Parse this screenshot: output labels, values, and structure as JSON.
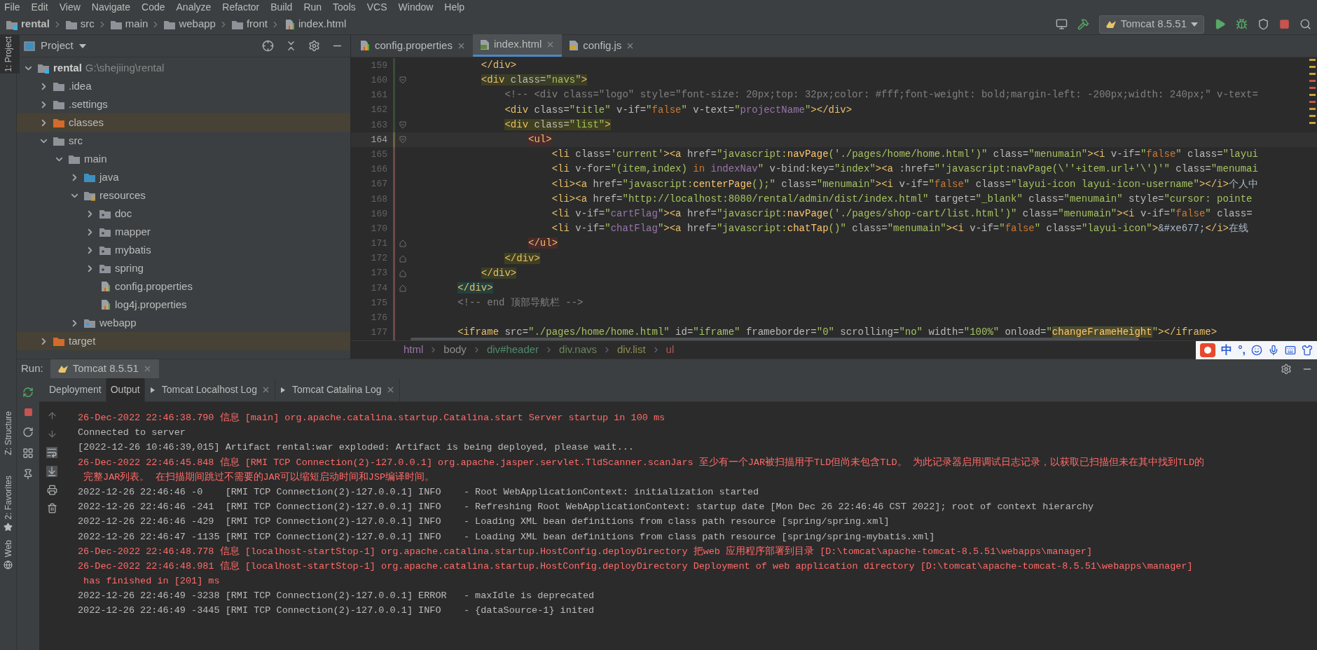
{
  "menu": [
    "File",
    "Edit",
    "View",
    "Navigate",
    "Code",
    "Analyze",
    "Refactor",
    "Build",
    "Run",
    "Tools",
    "VCS",
    "Window",
    "Help"
  ],
  "navbar": {
    "crumbs": [
      "rental",
      "src",
      "main",
      "webapp",
      "front",
      "index.html"
    ],
    "run_config": "Tomcat 8.5.51"
  },
  "side_tabs": [
    {
      "label": "1: Project",
      "selected": true
    },
    {
      "label": "Z: Structure",
      "selected": false
    },
    {
      "label": "2: Favorites",
      "selected": false
    },
    {
      "label": "Web",
      "selected": false
    }
  ],
  "project": {
    "title": "Project",
    "tree": [
      {
        "name": "rental",
        "path": "G:\\shejiing\\rental",
        "kind": "module",
        "expanded": true,
        "children": [
          {
            "name": ".idea",
            "kind": "folder",
            "expanded": false
          },
          {
            "name": ".settings",
            "kind": "folder",
            "expanded": false
          },
          {
            "name": "classes",
            "kind": "excluded",
            "expanded": false
          },
          {
            "name": "src",
            "kind": "folder",
            "expanded": true,
            "children": [
              {
                "name": "main",
                "kind": "folder",
                "expanded": true,
                "children": [
                  {
                    "name": "java",
                    "kind": "source",
                    "expanded": false
                  },
                  {
                    "name": "resources",
                    "kind": "resources",
                    "expanded": true,
                    "children": [
                      {
                        "name": "doc",
                        "kind": "package",
                        "expanded": false
                      },
                      {
                        "name": "mapper",
                        "kind": "package",
                        "expanded": false
                      },
                      {
                        "name": "mybatis",
                        "kind": "package",
                        "expanded": false
                      },
                      {
                        "name": "spring",
                        "kind": "package",
                        "expanded": false
                      },
                      {
                        "name": "config.properties",
                        "kind": "properties"
                      },
                      {
                        "name": "log4j.properties",
                        "kind": "properties"
                      }
                    ]
                  },
                  {
                    "name": "webapp",
                    "kind": "web",
                    "expanded": false
                  }
                ]
              }
            ]
          },
          {
            "name": "target",
            "kind": "excluded",
            "expanded": false
          }
        ]
      }
    ]
  },
  "editor": {
    "tabs": [
      {
        "label": "config.properties",
        "kind": "properties",
        "selected": false
      },
      {
        "label": "index.html",
        "kind": "html",
        "selected": true
      },
      {
        "label": "config.js",
        "kind": "js",
        "selected": false
      }
    ],
    "lines": [
      {
        "number": "159",
        "current": false,
        "kind": "added",
        "fold_start": false,
        "fold_end": false,
        "tokens": [
          {
            "kind": "tag",
            "text": "            </div>"
          }
        ]
      },
      {
        "number": "160",
        "current": false,
        "kind": "added",
        "fold_start": true,
        "fold_end": false,
        "color": "#3b3d26",
        "tokens": [
          {
            "kind": "tag",
            "text": "            <div"
          },
          {
            "kind": "attr",
            "text": " class="
          },
          {
            "kind": "str",
            "text": "\"navs\""
          },
          {
            "kind": "tag",
            "text": ">"
          }
        ]
      },
      {
        "number": "161",
        "current": false,
        "kind": "added",
        "fold_start": false,
        "fold_end": false,
        "tokens": [
          {
            "kind": "cmt",
            "text": "                <!-- <div class=\"logo\" style=\"font-size: 20px;top: 32px;color: #fff;font-weight: bold;margin-left: -200px;width: 240px;\" v-text="
          }
        ]
      },
      {
        "number": "162",
        "current": false,
        "kind": "added",
        "fold_start": false,
        "fold_end": false,
        "tokens": [
          {
            "kind": "tag",
            "text": "                <div"
          },
          {
            "kind": "attr",
            "text": " class="
          },
          {
            "kind": "str",
            "text": "\"title\""
          },
          {
            "kind": "attr",
            "text": " v-if="
          },
          {
            "kind": "str",
            "text": "\""
          },
          {
            "kind": "kw",
            "text": "false"
          },
          {
            "kind": "str",
            "text": "\""
          },
          {
            "kind": "attr",
            "text": " v-text="
          },
          {
            "kind": "str",
            "text": "\""
          },
          {
            "kind": "var",
            "text": "projectName"
          },
          {
            "kind": "str",
            "text": "\""
          },
          {
            "kind": "tag",
            "text": "></div>"
          }
        ]
      },
      {
        "number": "163",
        "current": false,
        "kind": "added",
        "fold_start": true,
        "fold_end": false,
        "color": "#40401f",
        "tokens": [
          {
            "kind": "tag",
            "text": "                <div"
          },
          {
            "kind": "attr",
            "text": " class="
          },
          {
            "kind": "str",
            "text": "\"list\""
          },
          {
            "kind": "tag",
            "text": ">"
          }
        ]
      },
      {
        "number": "164",
        "current": true,
        "kind": "modified",
        "fold_start": true,
        "fold_end": false,
        "color": "#4a2a2a",
        "tokens": [
          {
            "kind": "tag",
            "text": "                    <ul>"
          }
        ]
      },
      {
        "number": "165",
        "current": false,
        "kind": "changed",
        "fold_start": false,
        "fold_end": false,
        "tokens": [
          {
            "kind": "tag",
            "text": "                        <li"
          },
          {
            "kind": "attr",
            "text": " class="
          },
          {
            "kind": "str",
            "text": "'current'"
          },
          {
            "kind": "tag",
            "text": "><a"
          },
          {
            "kind": "attr",
            "text": " href="
          },
          {
            "kind": "str",
            "text": "\"javascript:"
          },
          {
            "kind": "fn",
            "text": "navPage"
          },
          {
            "kind": "str",
            "text": "('./pages/home/home.html')\""
          },
          {
            "kind": "attr",
            "text": " class="
          },
          {
            "kind": "str",
            "text": "\"menumain\""
          },
          {
            "kind": "tag",
            "text": "><i"
          },
          {
            "kind": "attr",
            "text": " v-if="
          },
          {
            "kind": "str",
            "text": "\""
          },
          {
            "kind": "kw",
            "text": "false"
          },
          {
            "kind": "str",
            "text": "\""
          },
          {
            "kind": "attr",
            "text": " class="
          },
          {
            "kind": "str",
            "text": "\"layui"
          }
        ]
      },
      {
        "number": "166",
        "current": false,
        "kind": "changed",
        "fold_start": false,
        "fold_end": false,
        "tokens": [
          {
            "kind": "tag",
            "text": "                        <li"
          },
          {
            "kind": "attr",
            "text": " v-for="
          },
          {
            "kind": "str",
            "text": "\"(item,index)"
          },
          {
            "kind": "kw",
            "text": " in"
          },
          {
            "kind": "var",
            "text": " indexNav"
          },
          {
            "kind": "str",
            "text": "\""
          },
          {
            "kind": "attr",
            "text": " v-bind:key="
          },
          {
            "kind": "str",
            "text": "\"index\""
          },
          {
            "kind": "tag",
            "text": "><a"
          },
          {
            "kind": "attr",
            "text": " :href="
          },
          {
            "kind": "str",
            "text": "\"'javascript:navPage(\\''+item.url+'\\')'\""
          },
          {
            "kind": "attr",
            "text": " class="
          },
          {
            "kind": "str",
            "text": "\"menumai"
          }
        ]
      },
      {
        "number": "167",
        "current": false,
        "kind": "changed",
        "fold_start": false,
        "fold_end": false,
        "tokens": [
          {
            "kind": "tag",
            "text": "                        <li><a"
          },
          {
            "kind": "attr",
            "text": " href="
          },
          {
            "kind": "str",
            "text": "\"javascript:"
          },
          {
            "kind": "fn",
            "text": "centerPage"
          },
          {
            "kind": "str",
            "text": "();\""
          },
          {
            "kind": "attr",
            "text": " class="
          },
          {
            "kind": "str",
            "text": "\"menumain\""
          },
          {
            "kind": "tag",
            "text": "><i"
          },
          {
            "kind": "attr",
            "text": " v-if="
          },
          {
            "kind": "str",
            "text": "\""
          },
          {
            "kind": "kw",
            "text": "false"
          },
          {
            "kind": "str",
            "text": "\""
          },
          {
            "kind": "attr",
            "text": " class="
          },
          {
            "kind": "str",
            "text": "\"layui-icon layui-icon-username\""
          },
          {
            "kind": "tag",
            "text": "></i>"
          },
          {
            "kind": "text",
            "text": "个人中"
          }
        ]
      },
      {
        "number": "168",
        "current": false,
        "kind": "changed",
        "fold_start": false,
        "fold_end": false,
        "tokens": [
          {
            "kind": "tag",
            "text": "                        <li><a"
          },
          {
            "kind": "attr",
            "text": " href="
          },
          {
            "kind": "str",
            "text": "\"http://localhost:8080/rental/admin/dist/index.html\""
          },
          {
            "kind": "attr",
            "text": " target="
          },
          {
            "kind": "str",
            "text": "\"_blank\""
          },
          {
            "kind": "attr",
            "text": " class="
          },
          {
            "kind": "str",
            "text": "\"menumain\""
          },
          {
            "kind": "attr",
            "text": " style="
          },
          {
            "kind": "str",
            "text": "\"cursor: pointe"
          }
        ]
      },
      {
        "number": "169",
        "current": false,
        "kind": "changed",
        "fold_start": false,
        "fold_end": false,
        "tokens": [
          {
            "kind": "tag",
            "text": "                        <li"
          },
          {
            "kind": "attr",
            "text": " v-if="
          },
          {
            "kind": "str",
            "text": "\""
          },
          {
            "kind": "var",
            "text": "cartFlag"
          },
          {
            "kind": "str",
            "text": "\""
          },
          {
            "kind": "tag",
            "text": "><a"
          },
          {
            "kind": "attr",
            "text": " href="
          },
          {
            "kind": "str",
            "text": "\"javascript:"
          },
          {
            "kind": "fn",
            "text": "navPage"
          },
          {
            "kind": "str",
            "text": "('./pages/shop-cart/list.html')\""
          },
          {
            "kind": "attr",
            "text": " class="
          },
          {
            "kind": "str",
            "text": "\"menumain\""
          },
          {
            "kind": "tag",
            "text": "><i"
          },
          {
            "kind": "attr",
            "text": " v-if="
          },
          {
            "kind": "str",
            "text": "\""
          },
          {
            "kind": "kw",
            "text": "false"
          },
          {
            "kind": "str",
            "text": "\""
          },
          {
            "kind": "attr",
            "text": " class="
          }
        ]
      },
      {
        "number": "170",
        "current": false,
        "kind": "changed",
        "fold_start": false,
        "fold_end": false,
        "tokens": [
          {
            "kind": "tag",
            "text": "                        <li"
          },
          {
            "kind": "attr",
            "text": " v-if="
          },
          {
            "kind": "str",
            "text": "\""
          },
          {
            "kind": "var",
            "text": "chatFlag"
          },
          {
            "kind": "str",
            "text": "\""
          },
          {
            "kind": "tag",
            "text": "><a"
          },
          {
            "kind": "attr",
            "text": " href="
          },
          {
            "kind": "str",
            "text": "\"javascript:"
          },
          {
            "kind": "fn",
            "text": "chatTap"
          },
          {
            "kind": "str",
            "text": "()\""
          },
          {
            "kind": "attr",
            "text": " class="
          },
          {
            "kind": "str",
            "text": "\"menumain\""
          },
          {
            "kind": "tag",
            "text": "><i"
          },
          {
            "kind": "attr",
            "text": " v-if="
          },
          {
            "kind": "str",
            "text": "\""
          },
          {
            "kind": "kw",
            "text": "false"
          },
          {
            "kind": "str",
            "text": "\""
          },
          {
            "kind": "attr",
            "text": " class="
          },
          {
            "kind": "str",
            "text": "\"layui-icon\""
          },
          {
            "kind": "tag",
            "text": ">"
          },
          {
            "kind": "text",
            "text": "&#xe677;"
          },
          {
            "kind": "tag",
            "text": "</i>"
          },
          {
            "kind": "text",
            "text": "在线"
          }
        ]
      },
      {
        "number": "171",
        "current": false,
        "kind": "changed",
        "fold_start": false,
        "fold_end": true,
        "color": "#4a2a2a",
        "tokens": [
          {
            "kind": "tag",
            "text": "                    </ul>"
          }
        ]
      },
      {
        "number": "172",
        "current": false,
        "kind": "changed",
        "fold_start": false,
        "fold_end": true,
        "color": "#40401f",
        "tokens": [
          {
            "kind": "tag",
            "text": "                </div>"
          }
        ]
      },
      {
        "number": "173",
        "current": false,
        "kind": "changed",
        "fold_start": false,
        "fold_end": true,
        "color": "#3b3d26",
        "tokens": [
          {
            "kind": "tag",
            "text": "            </div>"
          }
        ]
      },
      {
        "number": "174",
        "current": false,
        "kind": "changed",
        "fold_start": false,
        "fold_end": true,
        "color": "#24403f",
        "tokens": [
          {
            "kind": "tag",
            "text": "        </div>"
          }
        ]
      },
      {
        "number": "175",
        "current": false,
        "kind": "changed",
        "fold_start": false,
        "fold_end": false,
        "tokens": [
          {
            "kind": "cmt",
            "text": "        <!-- end 顶部导航栏 -->"
          }
        ]
      },
      {
        "number": "176",
        "current": false,
        "kind": "changed",
        "fold_start": false,
        "fold_end": false
      },
      {
        "number": "177",
        "current": false,
        "kind": "changed",
        "fold_start": false,
        "fold_end": false,
        "tokens": [
          {
            "kind": "tag",
            "text": "        <iframe"
          },
          {
            "kind": "attr",
            "text": " src="
          },
          {
            "kind": "str",
            "text": "\"./pages/home/home.html\""
          },
          {
            "kind": "attr",
            "text": " id="
          },
          {
            "kind": "str",
            "text": "\"iframe\""
          },
          {
            "kind": "attr",
            "text": " frameborder="
          },
          {
            "kind": "str",
            "text": "\"0\""
          },
          {
            "kind": "attr",
            "text": " scrolling="
          },
          {
            "kind": "str",
            "text": "\"no\""
          },
          {
            "kind": "attr",
            "text": " width="
          },
          {
            "kind": "str",
            "text": "\"100%\""
          },
          {
            "kind": "attr",
            "text": " onload="
          },
          {
            "kind": "str",
            "text": "\""
          },
          {
            "kind": "fn",
            "text": "changeFrameHeight",
            "color": "#4b4a2c"
          },
          {
            "kind": "str",
            "text": "\""
          },
          {
            "kind": "tag",
            "text": "></iframe>"
          }
        ]
      }
    ],
    "breadcrumbs": [
      {
        "label": "html",
        "color": "#9876aa"
      },
      {
        "label": "body",
        "color": "#8c8c8c"
      },
      {
        "label": "div#header",
        "color": "#4e8a6a"
      },
      {
        "label": "div.navs",
        "color": "#6a8759"
      },
      {
        "label": "div.list",
        "color": "#8f8d4a"
      },
      {
        "label": "ul",
        "color": "#b05a5a"
      }
    ]
  },
  "ime": {
    "items": [
      "中",
      "°,"
    ]
  },
  "run": {
    "label": "Run:",
    "tab": "Tomcat 8.5.51",
    "tabs": [
      {
        "label": "Deployment",
        "closable": false,
        "selected": false
      },
      {
        "label": "Output",
        "closable": false,
        "selected": true
      },
      {
        "label": "Tomcat Localhost Log",
        "closable": true,
        "selected": false
      },
      {
        "label": "Tomcat Catalina Log",
        "closable": true,
        "selected": false
      }
    ],
    "log": [
      {
        "kind": "error",
        "text": "26-Dec-2022 22:46:38.790 信息 [main] org.apache.catalina.startup.Catalina.start Server startup in 100 ms"
      },
      {
        "kind": "info",
        "text": "Connected to server"
      },
      {
        "kind": "info",
        "text": "[2022-12-26 10:46:39,015] Artifact rental:war exploded: Artifact is being deployed, please wait..."
      },
      {
        "kind": "error",
        "text": "26-Dec-2022 22:46:45.848 信息 [RMI TCP Connection(2)-127.0.0.1] org.apache.jasper.servlet.TldScanner.scanJars 至少有一个JAR被扫描用于TLD但尚未包含TLD。 为此记录器启用调试日志记录，以获取已扫描但未在其中找到TLD的"
      },
      {
        "kind": "error",
        "text": " 完整JAR列表。 在扫描期间跳过不需要的JAR可以缩短启动时间和JSP编译时间。"
      },
      {
        "kind": "info",
        "text": "2022-12-26 22:46:46 -0    [RMI TCP Connection(2)-127.0.0.1] INFO    - Root WebApplicationContext: initialization started"
      },
      {
        "kind": "info",
        "text": "2022-12-26 22:46:46 -241  [RMI TCP Connection(2)-127.0.0.1] INFO    - Refreshing Root WebApplicationContext: startup date [Mon Dec 26 22:46:46 CST 2022]; root of context hierarchy"
      },
      {
        "kind": "info",
        "text": "2022-12-26 22:46:46 -429  [RMI TCP Connection(2)-127.0.0.1] INFO    - Loading XML bean definitions from class path resource [spring/spring.xml]"
      },
      {
        "kind": "info",
        "text": "2022-12-26 22:46:47 -1135 [RMI TCP Connection(2)-127.0.0.1] INFO    - Loading XML bean definitions from class path resource [spring/spring-mybatis.xml]"
      },
      {
        "kind": "error",
        "text": "26-Dec-2022 22:46:48.778 信息 [localhost-startStop-1] org.apache.catalina.startup.HostConfig.deployDirectory 把web 应用程序部署到目录 [D:\\tomcat\\apache-tomcat-8.5.51\\webapps\\manager]"
      },
      {
        "kind": "error",
        "text": "26-Dec-2022 22:46:48.981 信息 [localhost-startStop-1] org.apache.catalina.startup.HostConfig.deployDirectory Deployment of web application directory [D:\\tomcat\\apache-tomcat-8.5.51\\webapps\\manager]"
      },
      {
        "kind": "error",
        "text": " has finished in [201] ms"
      },
      {
        "kind": "info",
        "text": "2022-12-26 22:46:49 -3238 [RMI TCP Connection(2)-127.0.0.1] ERROR   - maxIdle is deprecated"
      },
      {
        "kind": "info",
        "text": "2022-12-26 22:46:49 -3445 [RMI TCP Connection(2)-127.0.0.1] INFO    - {dataSource-1} inited"
      }
    ]
  }
}
